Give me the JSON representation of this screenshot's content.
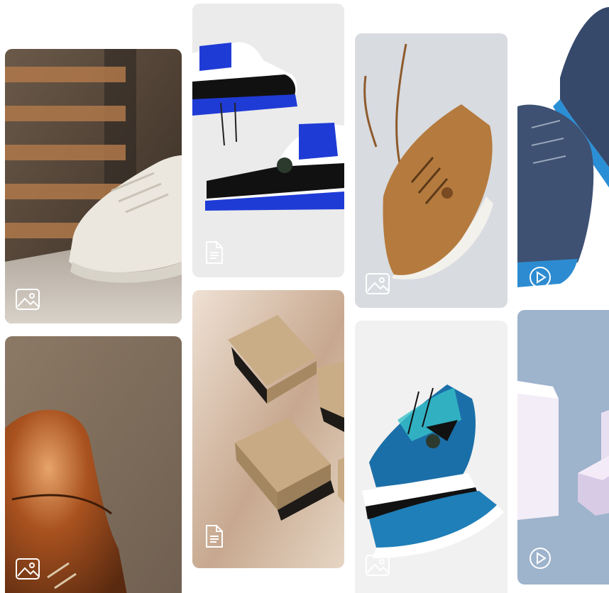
{
  "gallery": {
    "items": [
      {
        "subject": "white-chunky-sneaker",
        "media_type": "image",
        "badge_icon": "image-icon"
      },
      {
        "subject": "brown-leather-oxford",
        "media_type": "image",
        "badge_icon": "image-icon"
      },
      {
        "subject": "blue-black-high-top-sneakers",
        "media_type": "document",
        "badge_icon": "document-icon"
      },
      {
        "subject": "kraft-gift-boxes",
        "media_type": "document",
        "badge_icon": "document-icon"
      },
      {
        "subject": "tan-suede-sneaker",
        "media_type": "image",
        "badge_icon": "image-icon"
      },
      {
        "subject": "tie-dye-high-top-sneakers",
        "media_type": "image",
        "badge_icon": "image-icon"
      },
      {
        "subject": "navy-suede-boots",
        "media_type": "video",
        "badge_icon": "play-icon"
      },
      {
        "subject": "lavender-boxes",
        "media_type": "video",
        "badge_icon": "play-icon"
      }
    ]
  },
  "colors": {
    "page_background": "#ffffff",
    "badge_stroke": "#ffffff"
  }
}
